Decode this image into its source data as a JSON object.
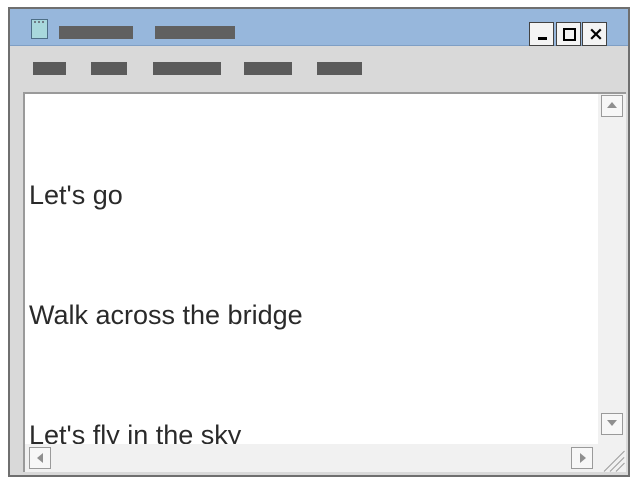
{
  "window": {
    "title_blocks": [
      "",
      ""
    ],
    "buttons": {
      "close_glyph": "×"
    }
  },
  "menu": {
    "items": [
      "",
      "",
      "",
      "",
      ""
    ]
  },
  "editor": {
    "lines": [
      "Let's go",
      "Walk across the bridge",
      "Let's fly in the sky"
    ]
  },
  "colors": {
    "title_bar": "#97b7dc",
    "window_bg": "#d9d9d9",
    "editor_bg": "#ffffff",
    "text": "#2a2a2a",
    "redacted_block": "#606060"
  },
  "icons": {
    "app": "text-editor-icon",
    "minimize": "minimize-icon",
    "maximize": "maximize-icon",
    "close": "close-icon",
    "scroll_up": "arrow-up-icon",
    "scroll_down": "arrow-down-icon",
    "scroll_left": "arrow-left-icon",
    "scroll_right": "arrow-right-icon",
    "resize": "resize-grip-icon"
  }
}
